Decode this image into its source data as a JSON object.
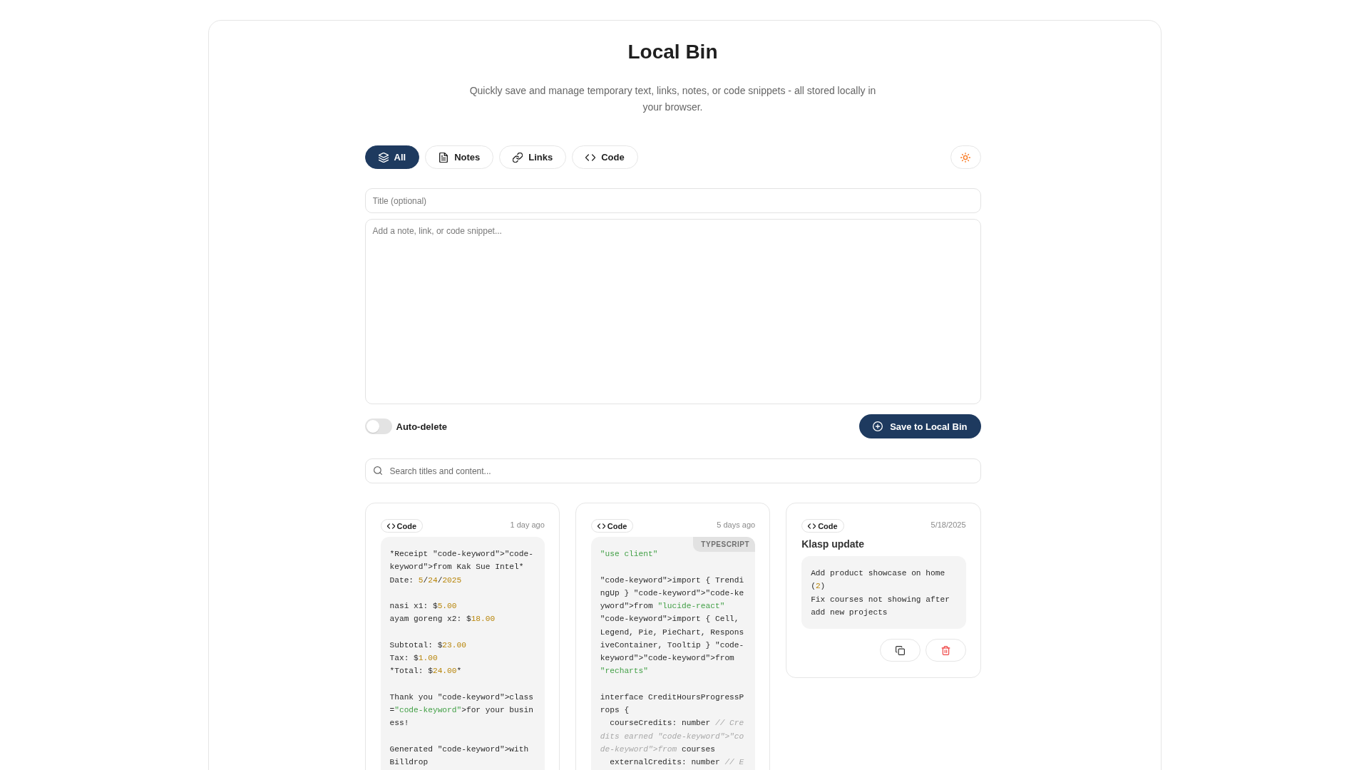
{
  "app": {
    "title": "Local Bin",
    "subtitle": "Quickly save and manage temporary text, links, notes, or code snippets - all stored locally in your browser."
  },
  "tabs": [
    {
      "label": "All",
      "kind": "all",
      "selected": true
    },
    {
      "label": "Notes",
      "kind": "notes",
      "selected": false
    },
    {
      "label": "Links",
      "kind": "links",
      "selected": false
    },
    {
      "label": "Code",
      "kind": "code",
      "selected": false
    }
  ],
  "title_field": {
    "placeholder": "Title (optional)"
  },
  "content_field": {
    "placeholder": "Add a note, link, or code snippet..."
  },
  "auto_delete": {
    "label": "Auto-delete",
    "on": false
  },
  "save_button": {
    "label": "Save to Local Bin"
  },
  "search": {
    "placeholder": "Search titles and content..."
  },
  "snippets": [
    {
      "kind": "code",
      "badge": "Code",
      "time": "1 day ago",
      "code": [
        {
          "text": "*Receipt \"code-keyword\">\"code-keyword\">from Kak Sue Intel*\nDate: ",
          "kind": "plain"
        },
        {
          "text": "5",
          "kind": "number"
        },
        {
          "text": "/",
          "kind": "plain"
        },
        {
          "text": "24",
          "kind": "number"
        },
        {
          "text": "/",
          "kind": "plain"
        },
        {
          "text": "2025",
          "kind": "number"
        },
        {
          "text": "\n\nnasi x1: $",
          "kind": "plain"
        },
        {
          "text": "5.00",
          "kind": "number"
        },
        {
          "text": "\nayam goreng x2: $",
          "kind": "plain"
        },
        {
          "text": "18.00",
          "kind": "number"
        },
        {
          "text": "\n\nSubtotal: $",
          "kind": "plain"
        },
        {
          "text": "23.00",
          "kind": "number"
        },
        {
          "text": "\nTax: $",
          "kind": "plain"
        },
        {
          "text": "1.00",
          "kind": "number"
        },
        {
          "text": "\n*Total: $",
          "kind": "plain"
        },
        {
          "text": "24.00",
          "kind": "number"
        },
        {
          "text": "*\n\nThank you \"code-keyword\">class=",
          "kind": "plain"
        },
        {
          "text": "\"code-keyword\"",
          "kind": "string"
        },
        {
          "text": ">for your business!\n\nGenerated \"code-keyword\">with Billdrop",
          "kind": "plain"
        }
      ]
    },
    {
      "kind": "code",
      "badge": "Code",
      "time": "5 days ago",
      "language": "TYPESCRIPT",
      "code": [
        {
          "text": "\"use client\"",
          "kind": "string"
        },
        {
          "text": "\n\n\"code-keyword\">import { TrendingUp } \"code-keyword\">\"code-keyword\">from ",
          "kind": "plain"
        },
        {
          "text": "\"lucide-react\"",
          "kind": "string"
        },
        {
          "text": "\n\"code-keyword\">import { Cell, Legend, Pie, PieChart, ResponsiveContainer, Tooltip } \"code-keyword\">\"code-keyword\">from ",
          "kind": "plain"
        },
        {
          "text": "\"recharts\"",
          "kind": "string"
        },
        {
          "text": "\n\ninterface CreditHoursProgressProps {\n  courseCredits: number ",
          "kind": "plain"
        },
        {
          "text": "// Credits earned \"code-keyword\">\"code-keyword\">from",
          "kind": "comment"
        },
        {
          "text": " courses\n  externalCredits: number ",
          "kind": "plain"
        },
        {
          "text": "// E",
          "kind": "comment"
        }
      ]
    },
    {
      "kind": "code",
      "badge": "Code",
      "time": "5/18/2025",
      "title": "Klasp update",
      "code": [
        {
          "text": "Add product showcase on home (",
          "kind": "plain"
        },
        {
          "text": "2",
          "kind": "number"
        },
        {
          "text": ")\nFix courses not showing after add new projects",
          "kind": "plain"
        }
      ],
      "actions": [
        {
          "kind": "copy"
        },
        {
          "kind": "delete"
        }
      ]
    }
  ]
}
